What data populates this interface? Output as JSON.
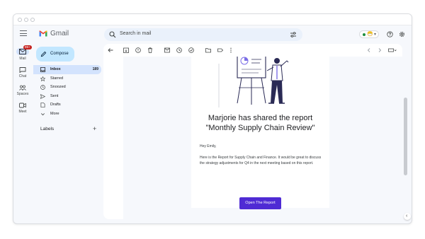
{
  "header": {
    "brand": "Gmail",
    "search_placeholder": "Search in mail",
    "status_emoji": "😷",
    "status_caret": "▾"
  },
  "rail": {
    "items": [
      {
        "label": "Mail",
        "badge": "99+"
      },
      {
        "label": "Chat"
      },
      {
        "label": "Spaces"
      },
      {
        "label": "Meet"
      }
    ]
  },
  "sidebar": {
    "compose_label": "Compose",
    "items": [
      {
        "label": "Inbox",
        "count": "189",
        "icon": "inbox-icon"
      },
      {
        "label": "Starred",
        "icon": "star-icon"
      },
      {
        "label": "Snoozed",
        "icon": "clock-icon"
      },
      {
        "label": "Sent",
        "icon": "send-icon"
      },
      {
        "label": "Drafts",
        "icon": "draft-icon"
      },
      {
        "label": "More",
        "icon": "chevron-down-icon"
      }
    ],
    "labels_title": "Labels",
    "labels_add": "+"
  },
  "email": {
    "title_line1": "Marjorie has shared the report",
    "title_line2": "\"Monthly Supply Chain Review\"",
    "greeting": "Hey Emily,",
    "body": "Here is the Report for Supply Chain and Finance. It would be great to discuss the strategy adjustments for Q4 in the next meeting based on this report.",
    "cta_label": "Open The Report"
  },
  "colors": {
    "accent": "#4f2bd4",
    "compose_bg": "#c2e7ff",
    "active_nav": "#d3e3fd",
    "badge": "#c5221f"
  }
}
